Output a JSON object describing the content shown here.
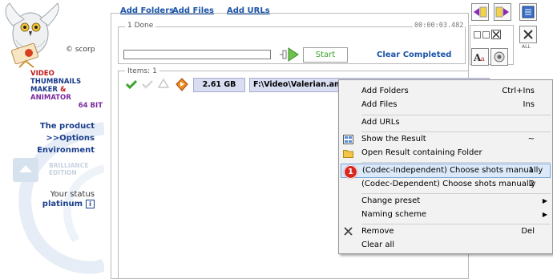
{
  "brand": {
    "company": "© scorp",
    "line1": "VIDEO",
    "line2": "THUMBNAILS",
    "line3_a": "MAKER",
    "line3_amp": " & ",
    "line3_b": "ANIMATOR",
    "line4": "64 BIT"
  },
  "sidebar": {
    "product": "The product",
    "options": ">>Options",
    "environment": "Environment",
    "edition_line1": "BRILLIANCE",
    "edition_line2": "EDITION",
    "status_label": "Your status",
    "status_value": "platinum",
    "info_glyph": "i"
  },
  "toolbar": {
    "add_folders": "Add Folders",
    "add_files": "Add Files",
    "add_urls": "Add URLs",
    "all_label": "ALL"
  },
  "job": {
    "group_label": "1 Done",
    "elapsed": "00:00:03.482",
    "progress": 0,
    "start_label": "Start",
    "clear_completed": "Clear Completed"
  },
  "items": {
    "label": "Items: 1",
    "size": "2.61 GB",
    "path": "F:\\Video\\Valerian.and.the"
  },
  "context_menu": {
    "items": [
      {
        "label": "Add Folders",
        "shortcut": "Ctrl+Ins"
      },
      {
        "label": "Add Files",
        "shortcut": "Ins"
      },
      {
        "label": "Add URLs",
        "shortcut": ""
      },
      {
        "label": "Show the Result",
        "shortcut": "~"
      },
      {
        "label": "Open Result containing Folder",
        "shortcut": ""
      },
      {
        "label": "(Codec-Independent) Choose shots manually",
        "shortcut": "1"
      },
      {
        "label": "(Codec-Dependent) Choose shots manually",
        "shortcut": "2"
      },
      {
        "label": "Change preset",
        "shortcut": ""
      },
      {
        "label": "Naming scheme",
        "shortcut": ""
      },
      {
        "label": "Remove",
        "shortcut": "Del"
      },
      {
        "label": "Clear all",
        "shortcut": ""
      }
    ],
    "step_badge": "1",
    "submenu_arrow": "▶"
  },
  "colors": {
    "link": "#1a54a8",
    "start_green": "#3aa32a",
    "selection_bg": "#dbe9f9",
    "badge_red": "#d6281f"
  }
}
